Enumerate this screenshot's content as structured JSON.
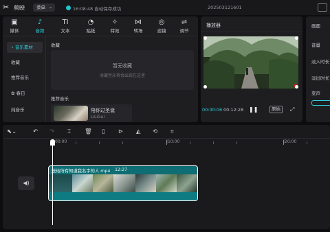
{
  "app": {
    "title": "剪映",
    "menu_label": "菜单",
    "save_status": "16:08:48 自动保存成功",
    "project_name": "202503121601"
  },
  "tool_tabs": [
    {
      "label": "媒体",
      "icon": "media-icon"
    },
    {
      "label": "音频",
      "icon": "audio-icon",
      "active": true
    },
    {
      "label": "文本",
      "icon": "text-icon"
    },
    {
      "label": "贴纸",
      "icon": "sticker-icon"
    },
    {
      "label": "特效",
      "icon": "effects-icon"
    },
    {
      "label": "转场",
      "icon": "transition-icon"
    },
    {
      "label": "滤镜",
      "icon": "filter-icon"
    },
    {
      "label": "调节",
      "icon": "adjust-icon"
    }
  ],
  "sidebar": {
    "items": [
      {
        "label": "• 音乐素材",
        "active": true
      },
      {
        "label": "收藏"
      },
      {
        "label": "推荐音乐"
      },
      {
        "label": "✿ 春日"
      },
      {
        "label": "纯音乐"
      }
    ]
  },
  "library": {
    "favorites_title": "收藏",
    "favorites_empty": "暂无收藏",
    "favorites_hint": "收藏音乐将会出现在这里",
    "recommended_title": "推荐音乐",
    "song": {
      "name": "陪你过圣诞",
      "artist": "LiLiGui"
    }
  },
  "player": {
    "title": "播放器",
    "current_time": "00:00:06",
    "total_time": "00:12:28",
    "original_label": "原始"
  },
  "properties": {
    "title": "画面",
    "labels": [
      "音量",
      "淡入时长",
      "淡出时长",
      "变声"
    ]
  },
  "timeline": {
    "ruler_labels": [
      "00:00",
      "|10:00",
      "|20:00"
    ],
    "clip": {
      "label": "送给所有知道我名字的人.mp4",
      "duration": "12:27"
    }
  }
}
